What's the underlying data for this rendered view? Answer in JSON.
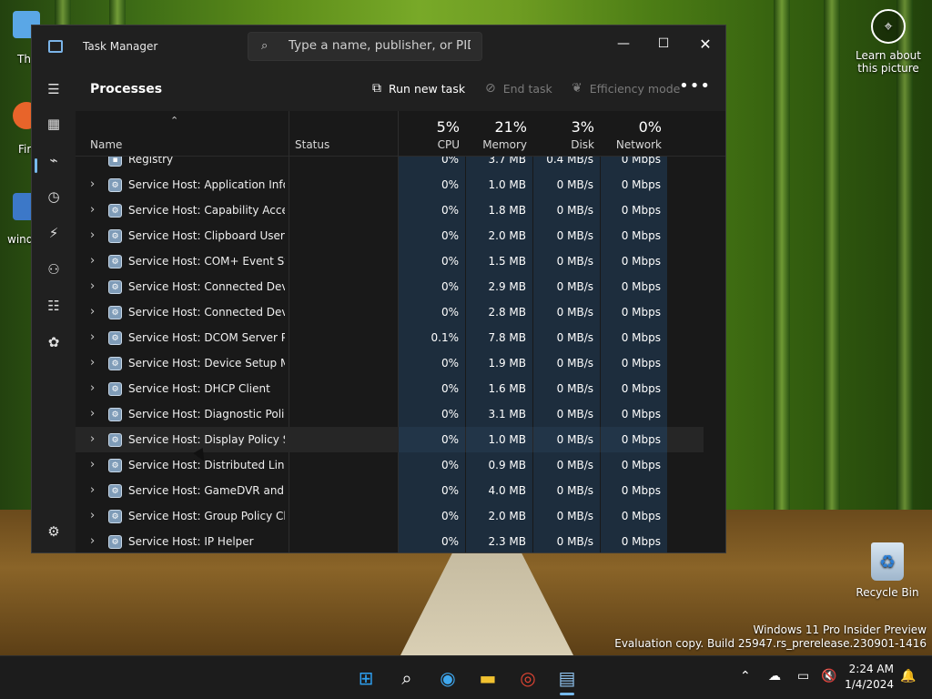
{
  "window": {
    "title": "Task Manager",
    "search_placeholder": "Type a name, publisher, or PID..."
  },
  "commandbar": {
    "page_title": "Processes",
    "run_new_task": "Run new task",
    "end_task": "End task",
    "efficiency_mode": "Efficiency mode"
  },
  "columns": {
    "name": "Name",
    "status": "Status",
    "cpu": {
      "pct": "5%",
      "label": "CPU"
    },
    "memory": {
      "pct": "21%",
      "label": "Memory"
    },
    "disk": {
      "pct": "3%",
      "label": "Disk"
    },
    "network": {
      "pct": "0%",
      "label": "Network"
    }
  },
  "processes": [
    {
      "name": "Registry",
      "expandable": false,
      "cpu": "0%",
      "memory": "3.7 MB",
      "disk": "0.4 MB/s",
      "network": "0 Mbps"
    },
    {
      "name": "Service Host: Application Infor...",
      "expandable": true,
      "cpu": "0%",
      "memory": "1.0 MB",
      "disk": "0 MB/s",
      "network": "0 Mbps"
    },
    {
      "name": "Service Host: Capability Acces...",
      "expandable": true,
      "cpu": "0%",
      "memory": "1.8 MB",
      "disk": "0 MB/s",
      "network": "0 Mbps"
    },
    {
      "name": "Service Host: Clipboard User S...",
      "expandable": true,
      "cpu": "0%",
      "memory": "2.0 MB",
      "disk": "0 MB/s",
      "network": "0 Mbps"
    },
    {
      "name": "Service Host: COM+ Event Sys...",
      "expandable": true,
      "cpu": "0%",
      "memory": "1.5 MB",
      "disk": "0 MB/s",
      "network": "0 Mbps"
    },
    {
      "name": "Service Host: Connected Devi...",
      "expandable": true,
      "cpu": "0%",
      "memory": "2.9 MB",
      "disk": "0 MB/s",
      "network": "0 Mbps"
    },
    {
      "name": "Service Host: Connected Devi...",
      "expandable": true,
      "cpu": "0%",
      "memory": "2.8 MB",
      "disk": "0 MB/s",
      "network": "0 Mbps"
    },
    {
      "name": "Service Host: DCOM Server Pr...",
      "expandable": true,
      "cpu": "0.1%",
      "memory": "7.8 MB",
      "disk": "0 MB/s",
      "network": "0 Mbps"
    },
    {
      "name": "Service Host: Device Setup Ma...",
      "expandable": true,
      "cpu": "0%",
      "memory": "1.9 MB",
      "disk": "0 MB/s",
      "network": "0 Mbps"
    },
    {
      "name": "Service Host: DHCP Client",
      "expandable": true,
      "cpu": "0%",
      "memory": "1.6 MB",
      "disk": "0 MB/s",
      "network": "0 Mbps"
    },
    {
      "name": "Service Host: Diagnostic Polic...",
      "expandable": true,
      "cpu": "0%",
      "memory": "3.1 MB",
      "disk": "0 MB/s",
      "network": "0 Mbps"
    },
    {
      "name": "Service Host: Display Policy Se...",
      "expandable": true,
      "cpu": "0%",
      "memory": "1.0 MB",
      "disk": "0 MB/s",
      "network": "0 Mbps"
    },
    {
      "name": "Service Host: Distributed Link ...",
      "expandable": true,
      "cpu": "0%",
      "memory": "0.9 MB",
      "disk": "0 MB/s",
      "network": "0 Mbps"
    },
    {
      "name": "Service Host: GameDVR and B...",
      "expandable": true,
      "cpu": "0%",
      "memory": "4.0 MB",
      "disk": "0 MB/s",
      "network": "0 Mbps"
    },
    {
      "name": "Service Host: Group Policy Cli...",
      "expandable": true,
      "cpu": "0%",
      "memory": "2.0 MB",
      "disk": "0 MB/s",
      "network": "0 Mbps"
    },
    {
      "name": "Service Host: IP Helper",
      "expandable": true,
      "cpu": "0%",
      "memory": "2.3 MB",
      "disk": "0 MB/s",
      "network": "0 Mbps"
    }
  ],
  "hover_row": 11,
  "desktop": {
    "learn_about": "Learn about this picture",
    "recycle_bin": "Recycle Bin",
    "left_label_1": "Th",
    "left_label_2": "Fir",
    "left_label_3": "wind",
    "watermark_line1": "Windows 11 Pro Insider Preview",
    "watermark_line2": "Evaluation copy. Build 25947.rs_prerelease.230901-1416"
  },
  "clock": {
    "time": "2:24 AM",
    "date": "1/4/2024"
  },
  "colors": {
    "accent": "#76b9ed",
    "metric_bg": "#1d2d3d",
    "window_bg": "#202020"
  }
}
